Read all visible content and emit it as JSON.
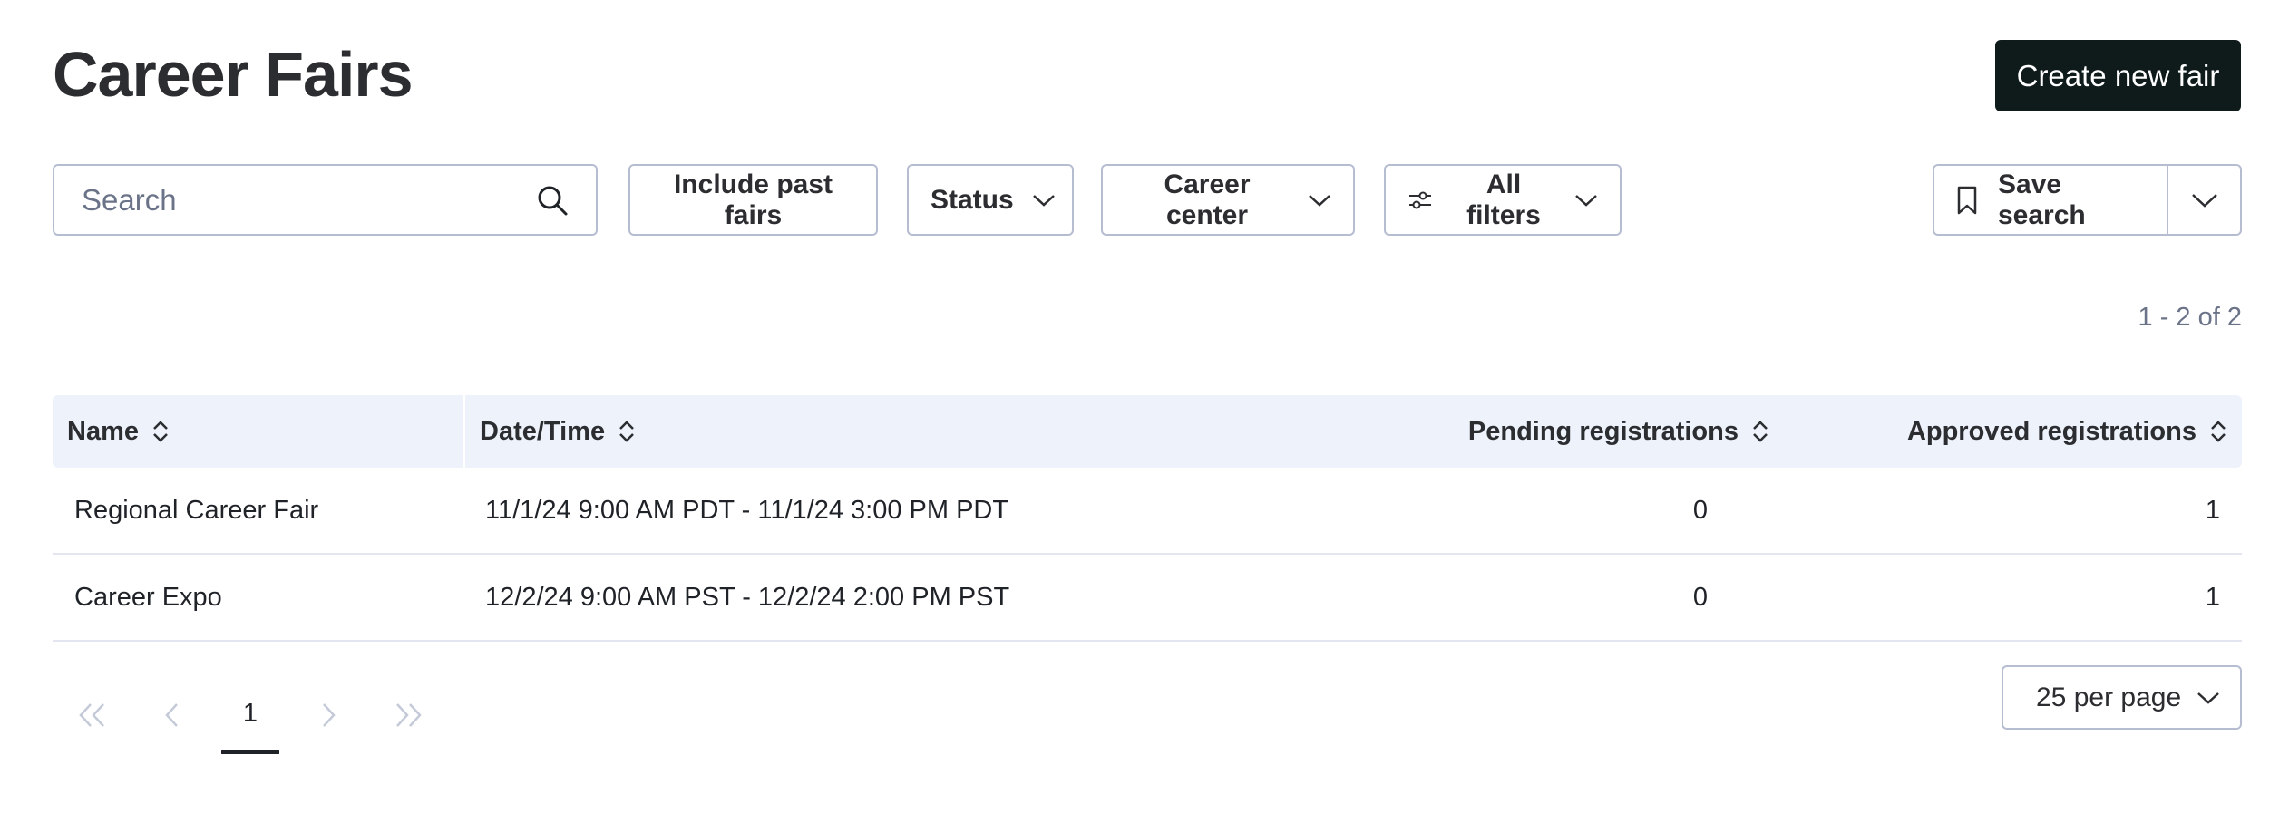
{
  "header": {
    "title": "Career Fairs",
    "create_label": "Create new fair"
  },
  "toolbar": {
    "search_placeholder": "Search",
    "search_value": "",
    "include_past_label": "Include past fairs",
    "status_label": "Status",
    "career_center_label": "Career center",
    "all_filters_label": "All filters",
    "save_search_label": "Save search"
  },
  "results": {
    "count_text": "1 - 2 of 2"
  },
  "table": {
    "columns": [
      "Name",
      "Date/Time",
      "Pending registrations",
      "Approved registrations"
    ],
    "rows": [
      {
        "name": "Regional Career Fair",
        "datetime": "11/1/24 9:00 AM PDT - 11/1/24 3:00 PM PDT",
        "pending": "0",
        "approved": "1"
      },
      {
        "name": "Career Expo",
        "datetime": "12/2/24 9:00 AM PST - 12/2/24 2:00 PM PST",
        "pending": "0",
        "approved": "1"
      }
    ]
  },
  "pagination": {
    "current_page": "1",
    "per_page_label": "25 per page"
  },
  "icons": {
    "search": "search-icon",
    "chevron": "chevron-down-icon",
    "sliders": "sliders-icon",
    "bookmark": "bookmark-icon",
    "sort": "sort-icon"
  },
  "colors": {
    "primary_button": "#0f1b1b",
    "header_bg": "#eef2fb",
    "border": "#b7bdd1"
  }
}
